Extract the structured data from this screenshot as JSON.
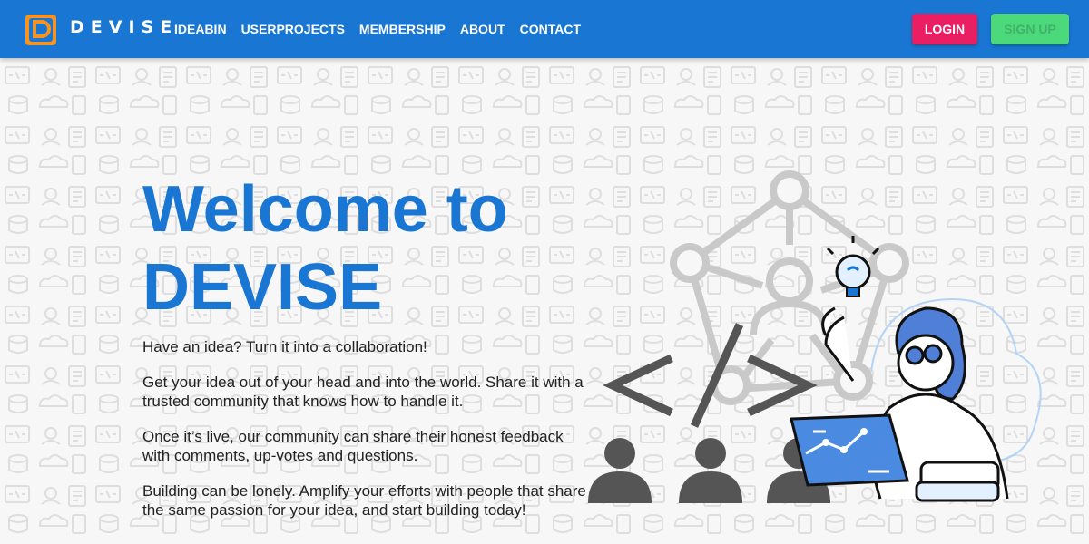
{
  "navbar": {
    "brand": "DEVISE",
    "links": [
      "IDEABIN",
      "USERPROJECTS",
      "MEMBERSHIP",
      "ABOUT",
      "CONTACT"
    ],
    "login_label": "LOGIN",
    "signup_label": "SIGN UP"
  },
  "hero": {
    "title_line1": "Welcome to",
    "title_line2": "DEVISE",
    "paragraphs": [
      "Have an idea? Turn it into a collaboration!",
      "Get your idea out of your head and into the world. Share it with a trusted community that knows how to handle it.",
      "Once it’s live, our community can share their honest feedback with comments, up-votes and questions.",
      "Building can be lonely. Amplify your efforts with people that share the same passion for your idea, and start building today!"
    ]
  },
  "colors": {
    "navbar": "#1976d2",
    "title": "#1976d2",
    "login": "#e91e63",
    "signup": "#4cd97b",
    "logo_orange": "#f7931e"
  },
  "icons": [
    "logo-icon",
    "code-brackets-icon",
    "network-icon",
    "user-icon",
    "lightbulb-icon",
    "laptop-icon"
  ]
}
